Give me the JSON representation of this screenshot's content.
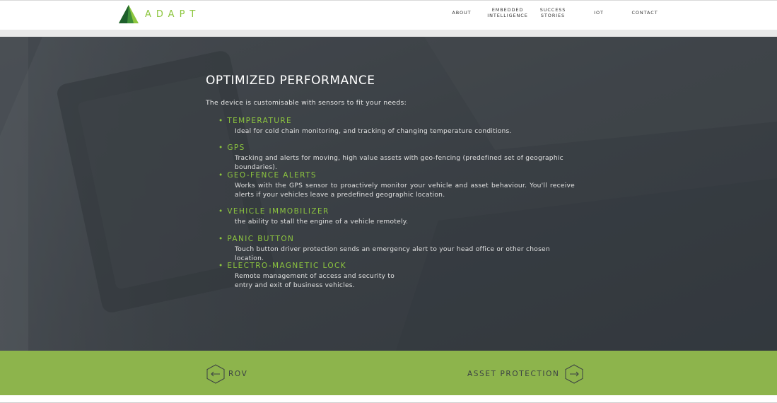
{
  "brand": {
    "logo_text": "ADAPT",
    "accent_color": "#8dc63f"
  },
  "nav": {
    "about": "ABOUT",
    "embedded": "EMBEDDED\nINTELLIGENCE",
    "success": "SUCCESS\nSTORIES",
    "iot": "IOT",
    "contact": "CONTACT"
  },
  "section": {
    "title": "OPTIMIZED PERFORMANCE",
    "intro": "The device is customisable with sensors to fit your needs:"
  },
  "features": [
    {
      "title": "• TEMPERATURE",
      "desc": "Ideal for cold chain monitoring, and tracking of changing temperature conditions."
    },
    {
      "title": "• GPS",
      "desc": "Tracking and alerts for moving, high value assets with geo-fencing (predefined set of geographic boundaries)."
    },
    {
      "title": "• GEO-FENCE ALERTS",
      "desc": "Works with the GPS sensor to proactively monitor your vehicle and asset behaviour. You'll receive alerts if your vehicles leave a predefined geographic location."
    },
    {
      "title": "• VEHICLE IMMOBILIZER",
      "desc": "the ability to stall the engine of a vehicle remotely."
    },
    {
      "title": "• PANIC BUTTON",
      "desc": "Touch button driver protection sends an emergency alert to your head office or other chosen location."
    },
    {
      "title": "• ELECTRO-MAGNETIC LOCK",
      "desc": "Remote management of access and security to entry and exit of business vehicles."
    }
  ],
  "pager": {
    "prev_label": "ROV",
    "prev_icon": "arrow-left-icon",
    "next_label": "ASSET PROTECTION",
    "next_icon": "arrow-right-icon",
    "bar_color": "#8db44c"
  }
}
